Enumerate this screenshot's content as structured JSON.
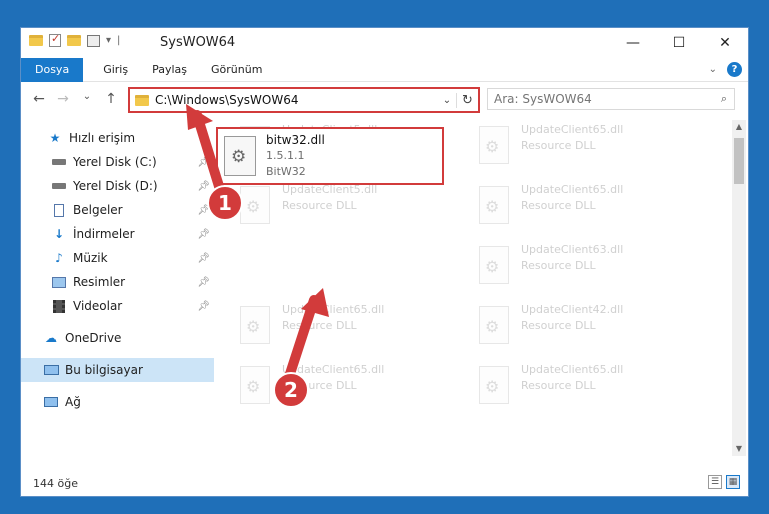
{
  "window": {
    "title": "SysWOW64"
  },
  "ribbon": {
    "tabs": [
      "Dosya",
      "Giriş",
      "Paylaş",
      "Görünüm"
    ],
    "help": "?"
  },
  "titlebar_controls": {
    "minimize": "—",
    "maximize": "☐",
    "close": "✕"
  },
  "navigation": {
    "back": "←",
    "forward": "→",
    "recent": "⌄",
    "up": "↑",
    "address": "C:\\Windows\\SysWOW64",
    "dropdown": "⌄",
    "refresh": "↻",
    "search_placeholder": "Ara: SysWOW64",
    "search_icon": "⌕"
  },
  "sidebar": {
    "items": [
      {
        "label": "Hızlı erişim",
        "icon": "star-icon"
      },
      {
        "label": "Yerel Disk (C:)",
        "icon": "drive-icon",
        "pinned": true
      },
      {
        "label": "Yerel Disk (D:)",
        "icon": "drive-icon",
        "pinned": true
      },
      {
        "label": "Belgeler",
        "icon": "documents-icon",
        "pinned": true
      },
      {
        "label": "İndirmeler",
        "icon": "download-icon",
        "pinned": true
      },
      {
        "label": "Müzik",
        "icon": "music-icon",
        "pinned": true
      },
      {
        "label": "Resimler",
        "icon": "pictures-icon",
        "pinned": true
      },
      {
        "label": "Videolar",
        "icon": "videos-icon",
        "pinned": true
      },
      {
        "label": "OneDrive",
        "icon": "cloud-icon"
      },
      {
        "label": "Bu bilgisayar",
        "icon": "computer-icon"
      },
      {
        "label": "Ağ",
        "icon": "network-icon"
      }
    ]
  },
  "files": {
    "faded": [
      {
        "name": "UpdateClient5.dll",
        "type": "Resource DLL"
      },
      {
        "name": "UpdateClient65.dll",
        "type": "Resource DLL"
      },
      {
        "name": "UpdateClient5.dll",
        "type": "Resource DLL"
      },
      {
        "name": "UpdateClient65.dll",
        "type": "Resource DLL"
      },
      {
        "name": "UpdateClient63.dll",
        "type": "Resource DLL"
      },
      {
        "name": "UpdateClient65.dll",
        "type": "Resource DLL"
      },
      {
        "name": "UpdateClient42.dll",
        "type": "Resource DLL"
      },
      {
        "name": "UpdateClient65.dll",
        "type": "Resource DLL"
      },
      {
        "name": "UpdateClient65.dll",
        "type": "Resource DLL"
      }
    ],
    "highlighted": {
      "name": "bitw32.dll",
      "version": "1.5.1.1",
      "description": "BitW32"
    }
  },
  "status": {
    "count": "144 öğe"
  },
  "annotations": {
    "step1": "1",
    "step2": "2",
    "color": "#d23b3b"
  }
}
